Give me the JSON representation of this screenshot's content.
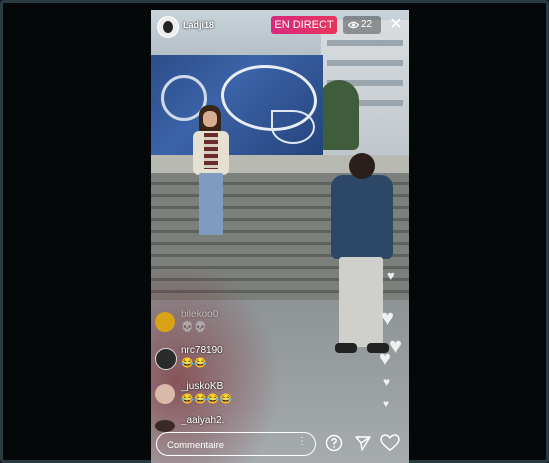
{
  "header": {
    "username": "Ladji18",
    "live_label": "EN DIRECT",
    "viewer_count": "22",
    "icons": [
      "avatar",
      "eye-icon",
      "close-icon"
    ]
  },
  "comments": [
    {
      "user": "bilekoo0",
      "message": "💀💀",
      "faded": true
    },
    {
      "user": "nrc78190",
      "message": "😂😂",
      "faded": false
    },
    {
      "user": "_juskoKB",
      "message": "😂😂😂😂",
      "faded": false
    },
    {
      "user": "_aalyah2.",
      "message": "",
      "faded": false
    }
  ],
  "footer": {
    "comment_placeholder": "Commentaire",
    "icons": [
      "more-dots-icon",
      "question-icon",
      "send-icon",
      "heart-icon"
    ]
  },
  "colors": {
    "live_badge": "#e0306c",
    "comment_emoji": "#ffd23a"
  }
}
